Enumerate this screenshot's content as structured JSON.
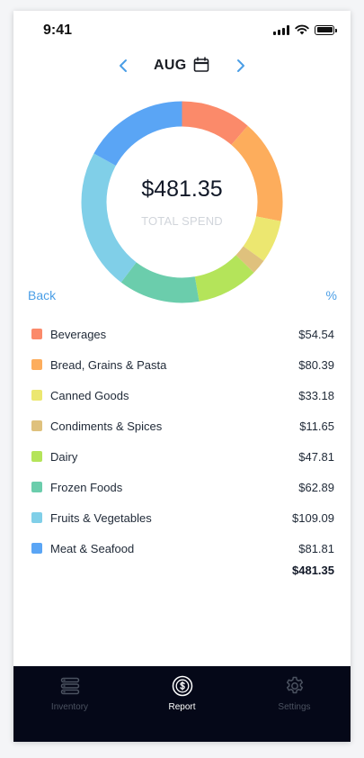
{
  "status": {
    "time": "9:41"
  },
  "header": {
    "month": "AUG"
  },
  "summary": {
    "total": "$481.35",
    "caption": "TOTAL SPEND"
  },
  "controls": {
    "back": "Back",
    "percent": "%"
  },
  "categories": [
    {
      "name": "Beverages",
      "amount": "$54.54",
      "value": 54.54,
      "color": "#fb8a6a"
    },
    {
      "name": "Bread, Grains & Pasta",
      "amount": "$80.39",
      "value": 80.39,
      "color": "#fdad5c"
    },
    {
      "name": "Canned Goods",
      "amount": "$33.18",
      "value": 33.18,
      "color": "#ece770"
    },
    {
      "name": "Condiments & Spices",
      "amount": "$11.65",
      "value": 11.65,
      "color": "#dfc17d"
    },
    {
      "name": "Dairy",
      "amount": "$47.81",
      "value": 47.81,
      "color": "#b4e45a"
    },
    {
      "name": "Frozen Foods",
      "amount": "$62.89",
      "value": 62.89,
      "color": "#6bcdac"
    },
    {
      "name": "Fruits & Vegetables",
      "amount": "$109.09",
      "value": 109.09,
      "color": "#80cfe8"
    },
    {
      "name": "Meat & Seafood",
      "amount": "$81.81",
      "value": 81.81,
      "color": "#5aa5f5"
    }
  ],
  "total_row": {
    "amount": "$481.35"
  },
  "tabs": [
    {
      "label": "Inventory",
      "icon": "list-icon",
      "active": false
    },
    {
      "label": "Report",
      "icon": "dollar-coin-icon",
      "active": true
    },
    {
      "label": "Settings",
      "icon": "gear-icon",
      "active": false
    }
  ],
  "colors": {
    "accent": "#4a9ee6",
    "tab_bar": "#050818"
  }
}
